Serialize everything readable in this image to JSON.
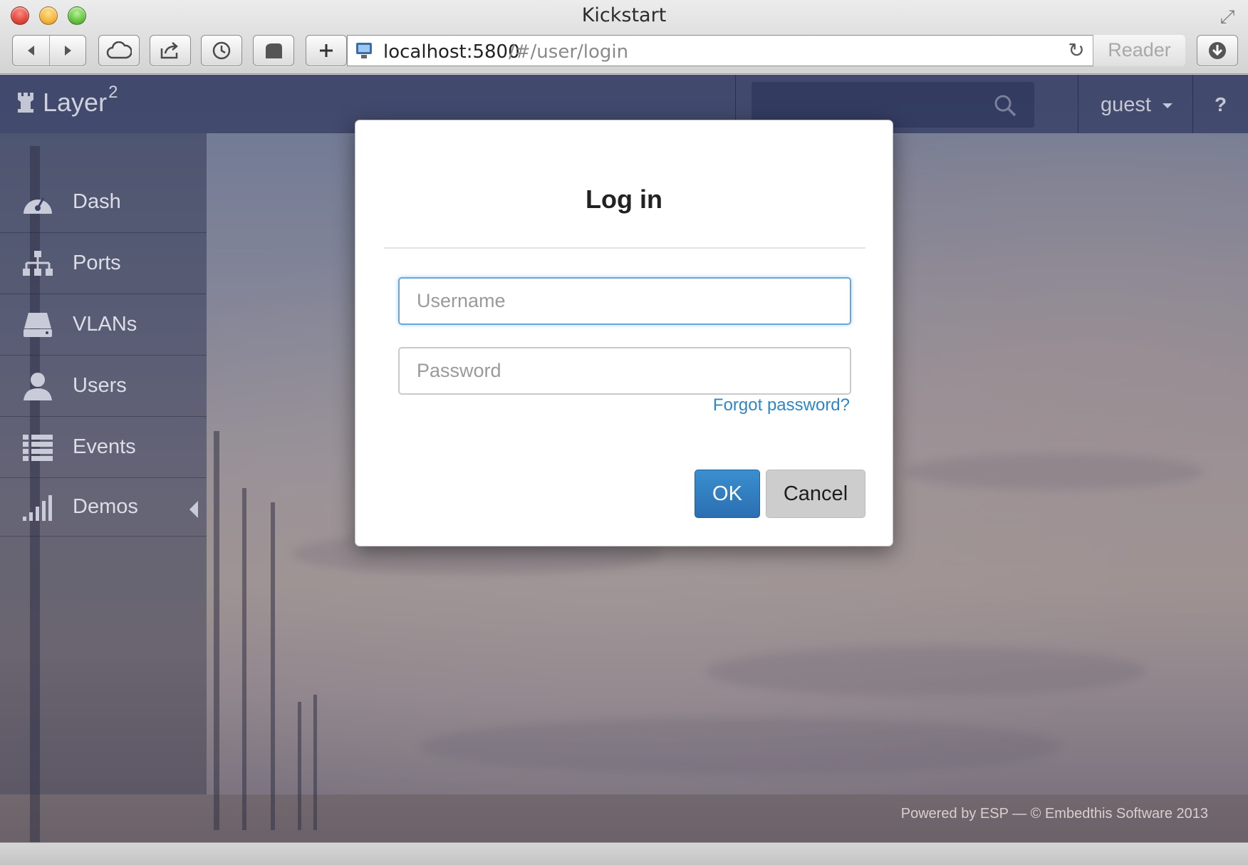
{
  "browser": {
    "window_title": "Kickstart",
    "url_host": "localhost:5800",
    "url_path": "/#/user/login",
    "reader_label": "Reader",
    "icons": {
      "back": "back-arrow-icon",
      "forward": "forward-arrow-icon",
      "icloud": "cloud-icon",
      "share": "share-icon",
      "history": "history-icon",
      "extension": "extension-icon",
      "new_tab": "plus-icon",
      "reload": "reload-icon",
      "download": "download-icon",
      "fullscreen": "fullscreen-icon"
    }
  },
  "app": {
    "brand": "Layer",
    "brand_sup": "2",
    "user_menu": "guest",
    "help": "?",
    "sidebar": {
      "items": [
        {
          "label": "Dash",
          "icon": "dashboard-icon"
        },
        {
          "label": "Ports",
          "icon": "sitemap-icon"
        },
        {
          "label": "VLANs",
          "icon": "drive-icon"
        },
        {
          "label": "Users",
          "icon": "user-icon"
        },
        {
          "label": "Events",
          "icon": "list-icon"
        },
        {
          "label": "Demos",
          "icon": "signal-icon"
        }
      ]
    },
    "footer": "Powered by ESP — © Embedthis Software 2013"
  },
  "login_modal": {
    "title": "Log in",
    "username_placeholder": "Username",
    "password_placeholder": "Password",
    "forgot_link": "Forgot password?",
    "ok_label": "OK",
    "cancel_label": "Cancel"
  },
  "colors": {
    "primary_button": "#2f7fc1",
    "link": "#2f86c6",
    "navbar": "#374066"
  }
}
